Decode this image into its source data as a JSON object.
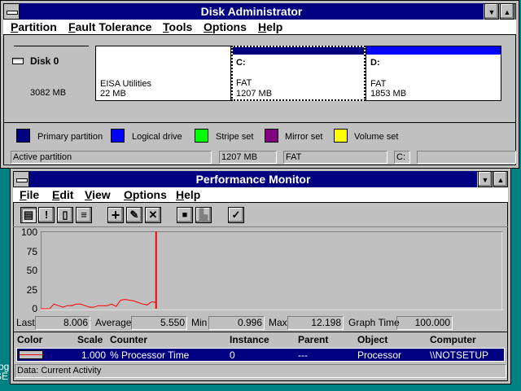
{
  "desktop": {
    "icon_text_1": "rog",
    "icon_text_2": "SE"
  },
  "disk_admin": {
    "title": "Disk Administrator",
    "menu": [
      "Partition",
      "Fault Tolerance",
      "Tools",
      "Options",
      "Help"
    ],
    "disk": {
      "label": "Disk 0",
      "size": "3082 MB"
    },
    "partitions": [
      {
        "name": "",
        "fs": "EISA Utilities",
        "size": "22 MB",
        "color": ""
      },
      {
        "name": "C:",
        "fs": "FAT",
        "size": "1207 MB",
        "color": "#000080",
        "selected": true
      },
      {
        "name": "D:",
        "fs": "FAT",
        "size": "1853 MB",
        "color": "#0000ff"
      }
    ],
    "legend": [
      {
        "label": "Primary partition",
        "color": "#000080"
      },
      {
        "label": "Logical drive",
        "color": "#0000ff"
      },
      {
        "label": "Stripe set",
        "color": "#00ff00"
      },
      {
        "label": "Mirror set",
        "color": "#800080"
      },
      {
        "label": "Volume set",
        "color": "#ffff00"
      }
    ],
    "status": {
      "type": "Active partition",
      "size": "1207 MB",
      "fs": "FAT",
      "drive": "C:",
      "extra": ""
    }
  },
  "perfmon": {
    "title": "Performance Monitor",
    "menu": [
      "File",
      "Edit",
      "View",
      "Options",
      "Help"
    ],
    "toolbar": [
      "chart-view",
      "alert-view",
      "log-view",
      "report-view",
      "add-counter",
      "edit-counter",
      "delete-counter",
      "update-now",
      "bookmark",
      "options"
    ],
    "stats": {
      "last_label": "Last",
      "last": "8.006",
      "avg_label": "Average",
      "avg": "5.550",
      "min_label": "Min",
      "min": "0.996",
      "max_label": "Max",
      "max": "12.198",
      "gt_label": "Graph Time",
      "gt": "100.000"
    },
    "legend_headers": {
      "color": "Color",
      "scale": "Scale",
      "counter": "Counter",
      "instance": "Instance",
      "parent": "Parent",
      "object": "Object",
      "computer": "Computer"
    },
    "legend_row": {
      "scale": "1.000",
      "counter": "% Processor Time",
      "instance": "0",
      "parent": "---",
      "object": "Processor",
      "computer": "\\\\NOTSETUP",
      "line_color": "#ff0000"
    },
    "status": "Data: Current Activity"
  },
  "chart_data": {
    "type": "line",
    "ylim": [
      0,
      100
    ],
    "yticks": [
      "100",
      "75",
      "50",
      "25",
      "0"
    ],
    "xlim": [
      0,
      100
    ],
    "current_sample": 25,
    "series": [
      {
        "name": "% Processor Time",
        "color": "#ff0000",
        "values": [
          0,
          0,
          0,
          6,
          4,
          2,
          4,
          4,
          6,
          6,
          4,
          2,
          2,
          4,
          4,
          4,
          6,
          3,
          11,
          12,
          11,
          10,
          8,
          6,
          5,
          9,
          8
        ]
      }
    ]
  }
}
